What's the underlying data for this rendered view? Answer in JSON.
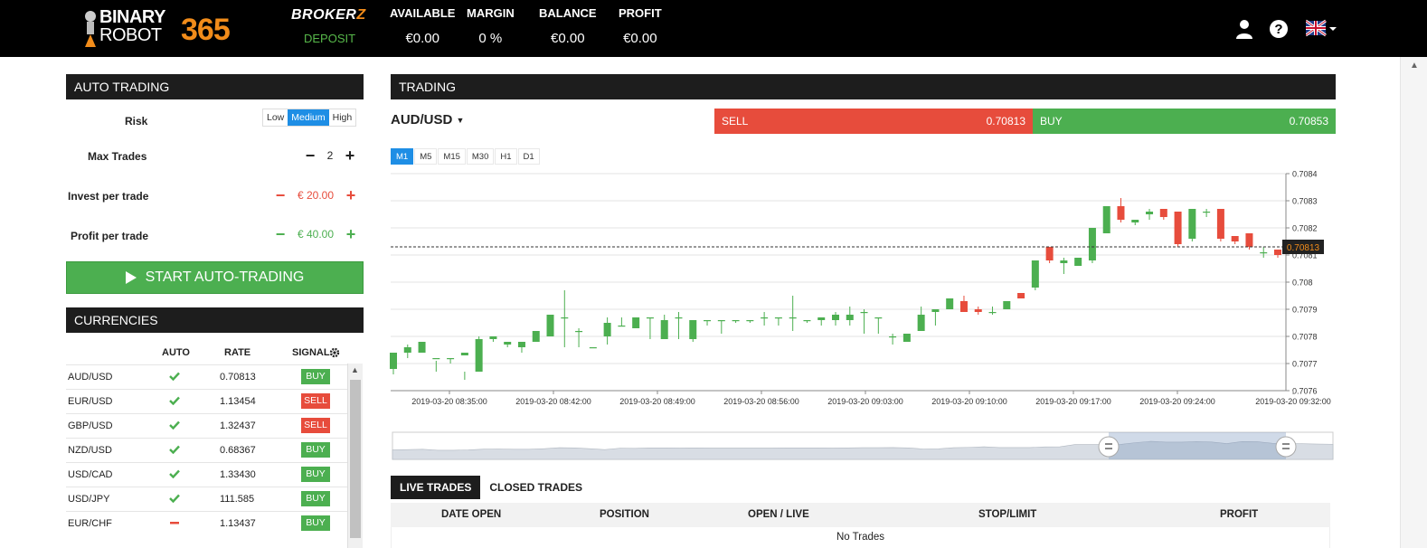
{
  "header": {
    "logo_word1": "BINARY",
    "logo_word2": "ROBOT",
    "logo_number": "365",
    "broker_a": "BROKER",
    "broker_b": "Z",
    "deposit": "DEPOSIT",
    "stats": [
      {
        "label": "AVAILABLE",
        "value": "€0.00"
      },
      {
        "label": "MARGIN",
        "value": "0 %"
      },
      {
        "label": "BALANCE",
        "value": "€0.00"
      },
      {
        "label": "PROFIT",
        "value": "€0.00"
      }
    ],
    "icons": [
      "user-icon",
      "help-icon",
      "uk-flag-icon"
    ]
  },
  "auto_trading": {
    "title": "AUTO TRADING",
    "risk_label": "Risk",
    "risk_options": [
      "Low",
      "Medium",
      "High"
    ],
    "risk_selected": "Medium",
    "max_trades_label": "Max Trades",
    "max_trades": "2",
    "invest_label": "Invest per trade",
    "invest_value": "€ 20.00",
    "profit_label": "Profit per trade",
    "profit_value": "€ 40.00",
    "start_button": "START AUTO-TRADING"
  },
  "currencies": {
    "title": "CURRENCIES",
    "columns": [
      "AUTO",
      "RATE",
      "SIGNAL"
    ],
    "rows": [
      {
        "pair": "AUD/USD",
        "auto": "check",
        "rate": "0.70813",
        "signal": "BUY"
      },
      {
        "pair": "EUR/USD",
        "auto": "check",
        "rate": "1.13454",
        "signal": "SELL"
      },
      {
        "pair": "GBP/USD",
        "auto": "check",
        "rate": "1.32437",
        "signal": "SELL"
      },
      {
        "pair": "NZD/USD",
        "auto": "check",
        "rate": "0.68367",
        "signal": "BUY"
      },
      {
        "pair": "USD/CAD",
        "auto": "check",
        "rate": "1.33430",
        "signal": "BUY"
      },
      {
        "pair": "USD/JPY",
        "auto": "check",
        "rate": "111.585",
        "signal": "BUY"
      },
      {
        "pair": "EUR/CHF",
        "auto": "dash",
        "rate": "1.13437",
        "signal": "BUY"
      }
    ]
  },
  "trading": {
    "title": "TRADING",
    "pair": "AUD/USD",
    "sell_label": "SELL",
    "sell_price": "0.70813",
    "buy_label": "BUY",
    "buy_price": "0.70853",
    "timeframes": [
      "M1",
      "M5",
      "M15",
      "M30",
      "H1",
      "D1"
    ],
    "timeframe_selected": "M1",
    "current_price_label": "0.70813",
    "colors": {
      "up": "#4caf50",
      "down": "#e74c3c",
      "accent": "#1e8ee5"
    }
  },
  "chart_data": {
    "type": "candlestick",
    "y_ticks": [
      "0.7084",
      "0.7083",
      "0.7082",
      "0.7081",
      "0.708",
      "0.7079",
      "0.7078",
      "0.7077",
      "0.7076"
    ],
    "ylim": [
      0.7076,
      0.7084
    ],
    "x_ticks": [
      "2019-03-20 08:35:00",
      "2019-03-20 08:42:00",
      "2019-03-20 08:49:00",
      "2019-03-20 08:56:00",
      "2019-03-20 09:03:00",
      "2019-03-20 09:10:00",
      "2019-03-20 09:17:00",
      "2019-03-20 09:24:00",
      "2019-03-20 09:32:00"
    ],
    "current_price": 0.70813,
    "candles": [
      [
        0.70768,
        0.70774,
        0.70766,
        0.70768
      ],
      [
        0.70774,
        0.70776,
        0.70772,
        0.70777
      ],
      [
        0.70774,
        0.70778,
        0.70774,
        0.70777
      ],
      [
        0.70772,
        0.70772,
        0.70767,
        0.70771
      ],
      [
        0.70772,
        0.70772,
        0.7077,
        0.70772
      ],
      [
        0.70773,
        0.70774,
        0.70764,
        0.70767
      ],
      [
        0.70767,
        0.70779,
        0.70767,
        0.7078
      ],
      [
        0.70779,
        0.7078,
        0.70778,
        0.70779
      ],
      [
        0.70777,
        0.70778,
        0.70776,
        0.70778
      ],
      [
        0.70776,
        0.70778,
        0.70774,
        0.70778
      ],
      [
        0.70778,
        0.70782,
        0.70778,
        0.7078
      ],
      [
        0.7078,
        0.70788,
        0.7078,
        0.70787
      ],
      [
        0.70787,
        0.70787,
        0.70776,
        0.70797
      ],
      [
        0.70782,
        0.70782,
        0.70776,
        0.70783
      ],
      [
        0.70776,
        0.70776,
        0.70776,
        0.70776
      ],
      [
        0.7078,
        0.70785,
        0.70777,
        0.70787
      ],
      [
        0.70784,
        0.70784,
        0.70784,
        0.70787
      ],
      [
        0.70783,
        0.70787,
        0.70783,
        0.70787
      ],
      [
        0.70787,
        0.70787,
        0.70779,
        0.70787
      ],
      [
        0.70779,
        0.70786,
        0.70779,
        0.70788
      ],
      [
        0.70787,
        0.70787,
        0.70779,
        0.70789
      ],
      [
        0.70779,
        0.70786,
        0.70778,
        0.70786
      ],
      [
        0.70786,
        0.70786,
        0.70784,
        0.70786
      ],
      [
        0.70786,
        0.70786,
        0.70781,
        0.70786
      ],
      [
        0.70786,
        0.70786,
        0.70785,
        0.70786
      ],
      [
        0.70786,
        0.70786,
        0.70785,
        0.70786
      ],
      [
        0.70787,
        0.70787,
        0.70784,
        0.70789
      ],
      [
        0.70787,
        0.70787,
        0.70784,
        0.70787
      ],
      [
        0.70787,
        0.70787,
        0.70782,
        0.70795
      ],
      [
        0.70786,
        0.70786,
        0.70785,
        0.70786
      ],
      [
        0.70786,
        0.70787,
        0.70784,
        0.70787
      ],
      [
        0.70786,
        0.70788,
        0.70784,
        0.70789
      ],
      [
        0.70786,
        0.70788,
        0.70784,
        0.70791
      ],
      [
        0.70789,
        0.70789,
        0.70781,
        0.7079
      ],
      [
        0.70787,
        0.70787,
        0.70781,
        0.70787
      ],
      [
        0.7078,
        0.7078,
        0.70777,
        0.70781
      ],
      [
        0.70778,
        0.70781,
        0.70778,
        0.70781
      ],
      [
        0.70782,
        0.70788,
        0.70782,
        0.70791
      ],
      [
        0.70789,
        0.7079,
        0.70784,
        0.7079
      ],
      [
        0.7079,
        0.70794,
        0.7079,
        0.70794
      ],
      [
        0.70793,
        0.70789,
        0.70789,
        0.70795
      ],
      [
        0.7079,
        0.70789,
        0.70788,
        0.70791
      ],
      [
        0.70789,
        0.70789,
        0.70788,
        0.70791
      ],
      [
        0.7079,
        0.70793,
        0.7079,
        0.70793
      ],
      [
        0.70796,
        0.70794,
        0.70794,
        0.70795
      ],
      [
        0.70798,
        0.70808,
        0.70797,
        0.70808
      ],
      [
        0.70813,
        0.70808,
        0.70807,
        0.70813
      ],
      [
        0.70807,
        0.70808,
        0.70803,
        0.70809
      ],
      [
        0.70806,
        0.70809,
        0.70806,
        0.70809
      ],
      [
        0.70808,
        0.7082,
        0.70807,
        0.7082
      ],
      [
        0.70818,
        0.70828,
        0.70818,
        0.70828
      ],
      [
        0.70828,
        0.70823,
        0.70822,
        0.70831
      ],
      [
        0.70822,
        0.70823,
        0.70821,
        0.70823
      ],
      [
        0.70825,
        0.70826,
        0.70823,
        0.70827
      ],
      [
        0.70827,
        0.70824,
        0.70823,
        0.70827
      ],
      [
        0.70826,
        0.70814,
        0.70813,
        0.70826
      ],
      [
        0.70816,
        0.70827,
        0.70815,
        0.70827
      ],
      [
        0.70826,
        0.70826,
        0.70824,
        0.70827
      ],
      [
        0.70827,
        0.70816,
        0.70815,
        0.70827
      ],
      [
        0.70817,
        0.70815,
        0.70814,
        0.70817
      ],
      [
        0.70818,
        0.70813,
        0.70812,
        0.70818
      ],
      [
        0.70811,
        0.70811,
        0.70809,
        0.70813
      ],
      [
        0.70812,
        0.7081,
        0.70809,
        0.70812
      ]
    ]
  },
  "trades": {
    "tabs": [
      "LIVE TRADES",
      "CLOSED TRADES"
    ],
    "tab_selected": "LIVE TRADES",
    "columns": [
      "DATE OPEN",
      "POSITION",
      "OPEN / LIVE",
      "STOP/LIMIT",
      "PROFIT"
    ],
    "empty_text": "No Trades"
  }
}
